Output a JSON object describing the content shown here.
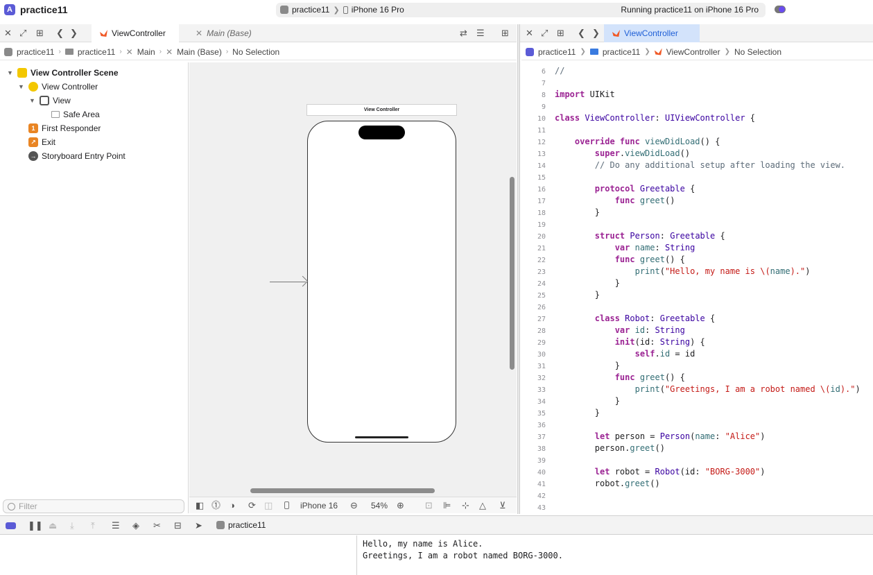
{
  "window": {
    "project_title": "practice11",
    "scheme": {
      "project": "practice11",
      "device": "iPhone 16 Pro"
    },
    "run_status": "Running practice11 on iPhone 16 Pro"
  },
  "left_tabs": [
    {
      "label": "ViewController",
      "icon": "swift-file-icon",
      "active": true
    },
    {
      "label": "Main (Base)",
      "icon": "interface-builder-icon",
      "active": false
    }
  ],
  "right_tabs": [
    {
      "label": "ViewController",
      "icon": "swift-file-icon",
      "active": true
    }
  ],
  "left_breadcrumb": [
    "practice11",
    "practice11",
    "Main",
    "Main (Base)",
    "No Selection"
  ],
  "right_breadcrumb": [
    "practice11",
    "practice11",
    "ViewController",
    "No Selection"
  ],
  "outline": {
    "items": [
      {
        "label": "View Controller Scene",
        "icon": "scene-icon"
      },
      {
        "label": "View Controller",
        "icon": "view-controller-icon"
      },
      {
        "label": "View",
        "icon": "view-icon"
      },
      {
        "label": "Safe Area",
        "icon": "safe-area-icon"
      },
      {
        "label": "First Responder",
        "icon": "first-responder-icon",
        "badge": "1"
      },
      {
        "label": "Exit",
        "icon": "exit-icon"
      },
      {
        "label": "Storyboard Entry Point",
        "icon": "entry-point-icon"
      }
    ],
    "filter_placeholder": "Filter"
  },
  "canvas": {
    "scene_title": "View Controller",
    "device_label": "iPhone 16",
    "zoom": "54%"
  },
  "code": {
    "lines": [
      {
        "n": "6",
        "html": "<span class=\"cm\">//</span>"
      },
      {
        "n": "7",
        "html": ""
      },
      {
        "n": "8",
        "html": "<span class=\"kw\">import</span> UIKit"
      },
      {
        "n": "9",
        "html": ""
      },
      {
        "n": "10",
        "html": "<span class=\"kw\">class</span> <span class=\"ty\">ViewController</span>: <span class=\"ty\">UIViewController</span> {"
      },
      {
        "n": "11",
        "html": ""
      },
      {
        "n": "12",
        "html": "    <span class=\"kw\">override func</span> <span class=\"fn\">viewDidLoad</span>() {"
      },
      {
        "n": "13",
        "html": "        <span class=\"kw\">super</span>.<span class=\"fn\">viewDidLoad</span>()"
      },
      {
        "n": "14",
        "html": "        <span class=\"cm\">// Do any additional setup after loading the view.</span>"
      },
      {
        "n": "15",
        "html": ""
      },
      {
        "n": "16",
        "html": "        <span class=\"kw\">protocol</span> <span class=\"ty\">Greetable</span> {"
      },
      {
        "n": "17",
        "html": "            <span class=\"kw\">func</span> <span class=\"fn\">greet</span>()"
      },
      {
        "n": "18",
        "html": "        }"
      },
      {
        "n": "19",
        "html": ""
      },
      {
        "n": "20",
        "html": "        <span class=\"kw\">struct</span> <span class=\"ty\">Person</span>: <span class=\"ty\">Greetable</span> {"
      },
      {
        "n": "21",
        "html": "            <span class=\"kw\">var</span> <span class=\"fn\">name</span>: <span class=\"ty\">String</span>"
      },
      {
        "n": "22",
        "html": "            <span class=\"kw\">func</span> <span class=\"fn\">greet</span>() {"
      },
      {
        "n": "23",
        "html": "                <span class=\"fn\">print</span>(<span class=\"str\">\"Hello, my name is \\(</span><span class=\"fn\">name</span><span class=\"str\">).\"</span>)"
      },
      {
        "n": "24",
        "html": "            }"
      },
      {
        "n": "25",
        "html": "        }"
      },
      {
        "n": "26",
        "html": ""
      },
      {
        "n": "27",
        "html": "        <span class=\"kw\">class</span> <span class=\"ty\">Robot</span>: <span class=\"ty\">Greetable</span> {"
      },
      {
        "n": "28",
        "html": "            <span class=\"kw\">var</span> <span class=\"fn\">id</span>: <span class=\"ty\">String</span>"
      },
      {
        "n": "29",
        "html": "            <span class=\"kw\">init</span>(id: <span class=\"ty\">String</span>) {"
      },
      {
        "n": "30",
        "html": "                <span class=\"kw\">self</span>.<span class=\"fn\">id</span> = id"
      },
      {
        "n": "31",
        "html": "            }"
      },
      {
        "n": "32",
        "html": "            <span class=\"kw\">func</span> <span class=\"fn\">greet</span>() {"
      },
      {
        "n": "33",
        "html": "                <span class=\"fn\">print</span>(<span class=\"str\">\"Greetings, I am a robot named \\(</span><span class=\"fn\">id</span><span class=\"str\">).\"</span>)"
      },
      {
        "n": "34",
        "html": "            }"
      },
      {
        "n": "35",
        "html": "        }"
      },
      {
        "n": "36",
        "html": ""
      },
      {
        "n": "37",
        "html": "        <span class=\"kw\">let</span> person = <span class=\"ty\">Person</span>(<span class=\"fn\">name</span>: <span class=\"str\">\"Alice\"</span>)"
      },
      {
        "n": "38",
        "html": "        person.<span class=\"fn\">greet</span>()"
      },
      {
        "n": "39",
        "html": ""
      },
      {
        "n": "40",
        "html": "        <span class=\"kw\">let</span> robot = <span class=\"ty\">Robot</span>(id: <span class=\"str\">\"BORG-3000\"</span>)"
      },
      {
        "n": "41",
        "html": "        robot.<span class=\"fn\">greet</span>()"
      },
      {
        "n": "42",
        "html": ""
      },
      {
        "n": "43",
        "html": ""
      }
    ]
  },
  "debug": {
    "target": "practice11"
  },
  "console": {
    "lines": [
      "Hello, my name is Alice.",
      "Greetings, I am a robot named BORG-3000."
    ]
  }
}
